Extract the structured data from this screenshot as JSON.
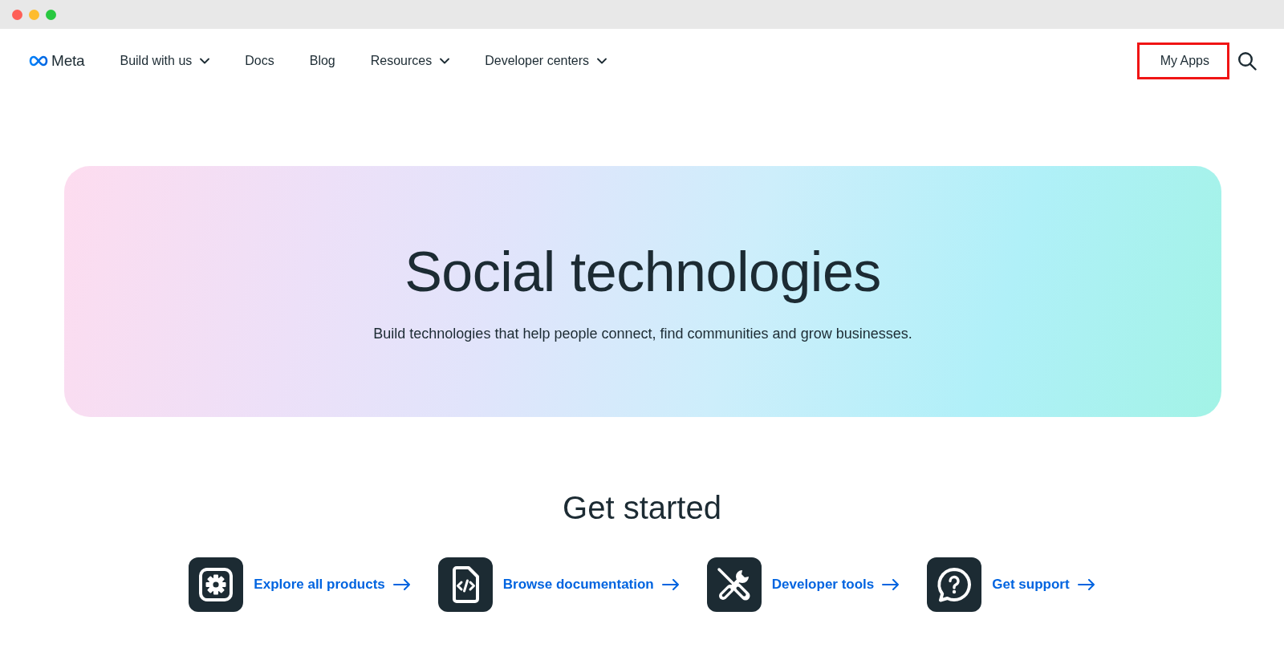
{
  "window": {
    "traffic_lights": [
      {
        "color": "#fe5f57"
      },
      {
        "color": "#febc2e"
      },
      {
        "color": "#28c840"
      }
    ]
  },
  "nav": {
    "logo": "Meta",
    "items": [
      {
        "label": "Build with us",
        "dropdown": true
      },
      {
        "label": "Docs",
        "dropdown": false
      },
      {
        "label": "Blog",
        "dropdown": false
      },
      {
        "label": "Resources",
        "dropdown": true
      },
      {
        "label": "Developer centers",
        "dropdown": true
      }
    ],
    "my_apps": {
      "label": "My Apps",
      "highlighted": true
    }
  },
  "hero": {
    "title": "Social technologies",
    "subtitle": "Build technologies that help people connect, find communities and grow businesses."
  },
  "get_started": {
    "heading": "Get started",
    "links": [
      {
        "kind": "products",
        "label": "Explore all products"
      },
      {
        "kind": "docs",
        "label": "Browse documentation"
      },
      {
        "kind": "tools",
        "label": "Developer tools"
      },
      {
        "kind": "support",
        "label": "Get support"
      }
    ]
  }
}
